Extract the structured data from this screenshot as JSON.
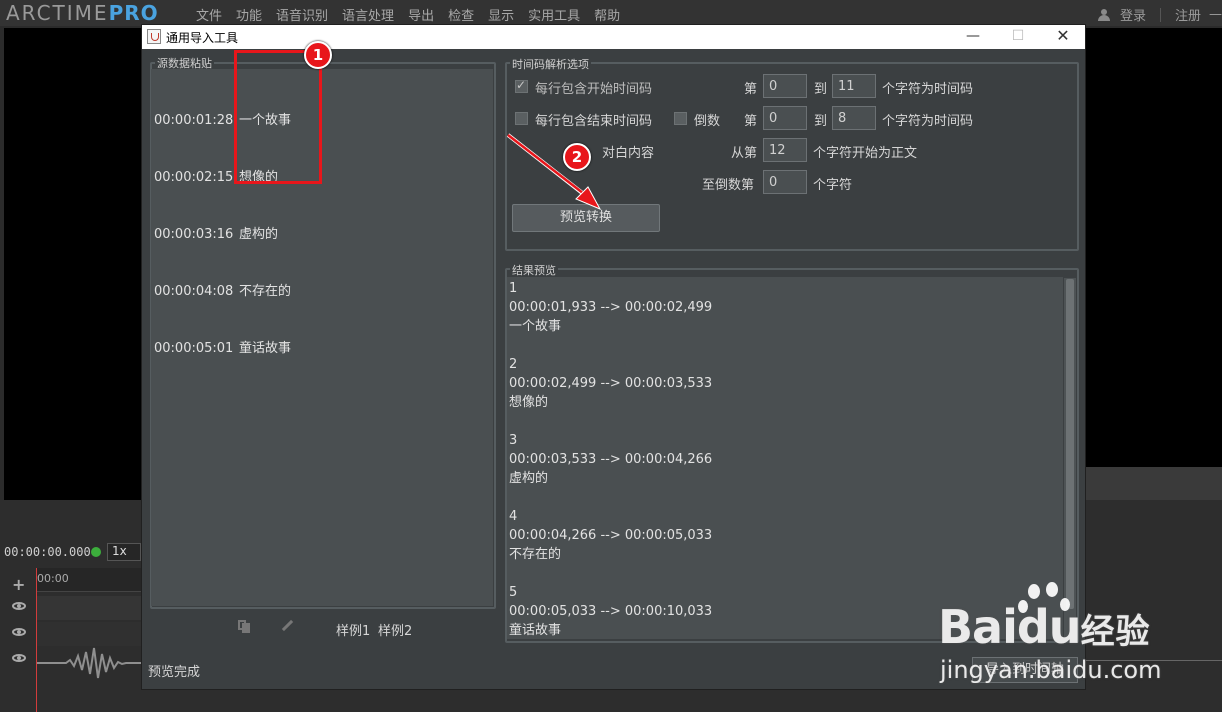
{
  "app": {
    "logo_text": "ARCTIME",
    "logo_pro": "PRO",
    "menu": [
      "文件",
      "功能",
      "语音识别",
      "语言处理",
      "导出",
      "检查",
      "显示",
      "实用工具",
      "帮助"
    ],
    "login_label": "登录",
    "register_label": "注册",
    "extra_label": "—",
    "timecode": "00:00:00.000",
    "speed": "1x",
    "ruler_label": "00:00",
    "plus_label": "+"
  },
  "dialog": {
    "title": "通用导入工具",
    "minimize": "—",
    "maximize": "☐",
    "close": "✕",
    "source_group_title": "源数据粘贴",
    "source_lines": [
      {
        "tc": "00:00:01:28",
        "text": "一个故事"
      },
      {
        "tc": "00:00:02:15",
        "text": "想像的"
      },
      {
        "tc": "00:00:03:16",
        "text": "虚构的"
      },
      {
        "tc": "00:00:04:08",
        "text": "不存在的"
      },
      {
        "tc": "00:00:05:01",
        "text": "童话故事"
      }
    ],
    "sample1": "样例1",
    "sample2": "样例2",
    "status": "预览完成",
    "options_group_title": "时间码解析选项",
    "opt_start_label": "每行包含开始时间码",
    "opt_start_checked": true,
    "opt_end_label": "每行包含结束时间码",
    "opt_end_checked": false,
    "opt_reverse_label": "倒数",
    "opt_reverse_checked": false,
    "row1": {
      "prefix": "第",
      "from": "0",
      "to_label": "到",
      "to": "11",
      "suffix": "个字符为时间码"
    },
    "row2": {
      "prefix": "第",
      "from": "0",
      "to_label": "到",
      "to": "8",
      "suffix": "个字符为时间码"
    },
    "dialog_content_label": "对白内容",
    "from_nth_label": "从第",
    "from_nth_value": "12",
    "from_nth_suffix": "个字符开始为正文",
    "to_last_label": "至倒数第",
    "to_last_value": "0",
    "to_last_suffix": "个字符",
    "preview_button": "预览转换",
    "result_group_title": "结果预览",
    "results": [
      {
        "index": "1",
        "time": "00:00:01,933 --> 00:00:02,499",
        "text": "一个故事"
      },
      {
        "index": "2",
        "time": "00:00:02,499 --> 00:00:03,533",
        "text": "想像的"
      },
      {
        "index": "3",
        "time": "00:00:03,533 --> 00:00:04,266",
        "text": "虚构的"
      },
      {
        "index": "4",
        "time": "00:00:04,266 --> 00:00:05,033",
        "text": "不存在的"
      },
      {
        "index": "5",
        "time": "00:00:05,033 --> 00:00:10,033",
        "text": "童话故事"
      }
    ],
    "import_button": "导入到时间轴"
  },
  "annotations": {
    "badge1": "1",
    "badge2": "2",
    "color": "#e8161b"
  },
  "watermark": {
    "brand_a": "Bai",
    "brand_b": "du",
    "brand_c": "经验",
    "url": "jingyan.baidu.com"
  }
}
